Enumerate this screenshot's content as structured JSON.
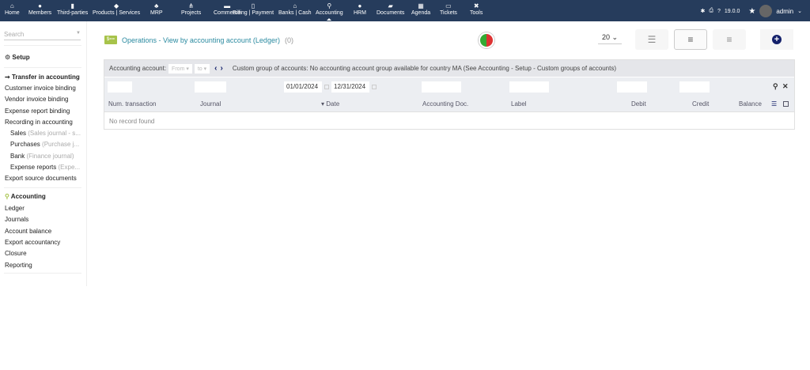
{
  "topmenu": [
    {
      "label": "Home",
      "icon": "home-icon",
      "glyph": "⌂"
    },
    {
      "label": "Members",
      "icon": "user-icon",
      "glyph": "●"
    },
    {
      "label": "Third-parties",
      "icon": "building-icon",
      "glyph": "▮"
    },
    {
      "label": "Products | Services",
      "icon": "cube-icon",
      "glyph": "◆"
    },
    {
      "label": "MRP",
      "icon": "cubes-icon",
      "glyph": "♣"
    },
    {
      "label": "Projects",
      "icon": "sitemap-icon",
      "glyph": "⋔"
    },
    {
      "label": "Commerce",
      "icon": "suitcase-icon",
      "glyph": "▬"
    },
    {
      "label": "Billing | Payment",
      "icon": "invoice-icon",
      "glyph": "▯"
    },
    {
      "label": "Banks | Cash",
      "icon": "bank-icon",
      "glyph": "⌂"
    },
    {
      "label": "Accounting",
      "icon": "search-dollar-icon",
      "glyph": "⚲"
    },
    {
      "label": "HRM",
      "icon": "user-tie-icon",
      "glyph": "●"
    },
    {
      "label": "Documents",
      "icon": "folder-icon",
      "glyph": "▰"
    },
    {
      "label": "Agenda",
      "icon": "calendar-icon",
      "glyph": "▦"
    },
    {
      "label": "Tickets",
      "icon": "ticket-icon",
      "glyph": "▭"
    },
    {
      "label": "Tools",
      "icon": "tools-icon",
      "glyph": "✖"
    }
  ],
  "topright": {
    "version": "19.0.0",
    "user": "admin"
  },
  "sidebar": {
    "search_placeholder": "Search",
    "setup": "Setup",
    "transfer": "Transfer in accounting",
    "items": [
      "Customer invoice binding",
      "Vendor invoice binding",
      "Expense report binding",
      "Recording in accounting"
    ],
    "journals": [
      {
        "label": "Sales",
        "note": "(Sales journal - s..."
      },
      {
        "label": "Purchases",
        "note": "(Purchase j..."
      },
      {
        "label": "Bank",
        "note": "(Finance journal)"
      },
      {
        "label": "Expense reports",
        "note": "(Expe..."
      }
    ],
    "export_source": "Export source documents",
    "accounting": "Accounting",
    "acc_items": [
      "Ledger",
      "Journals",
      "Account balance",
      "Export accountancy",
      "Closure",
      "Reporting"
    ]
  },
  "page": {
    "title": "Operations - View by accounting account (Ledger)",
    "count": "(0)",
    "per_page": "20"
  },
  "filter": {
    "label": "Accounting account:",
    "from": "From",
    "to": "to",
    "group_text": "Custom group of accounts: No accounting account group available for country MA (See Accounting - Setup - Custom groups of accounts)"
  },
  "dates": {
    "start": "01/01/2024",
    "end": "12/31/2024"
  },
  "columns": [
    "Num. transaction",
    "Journal",
    "Date",
    "Accounting Doc.",
    "Label",
    "Debit",
    "Credit",
    "Balance"
  ],
  "empty": "No record found",
  "colors": {
    "topbar": "#263c5c",
    "link": "#2a8aa0",
    "accent": "#14216b"
  }
}
